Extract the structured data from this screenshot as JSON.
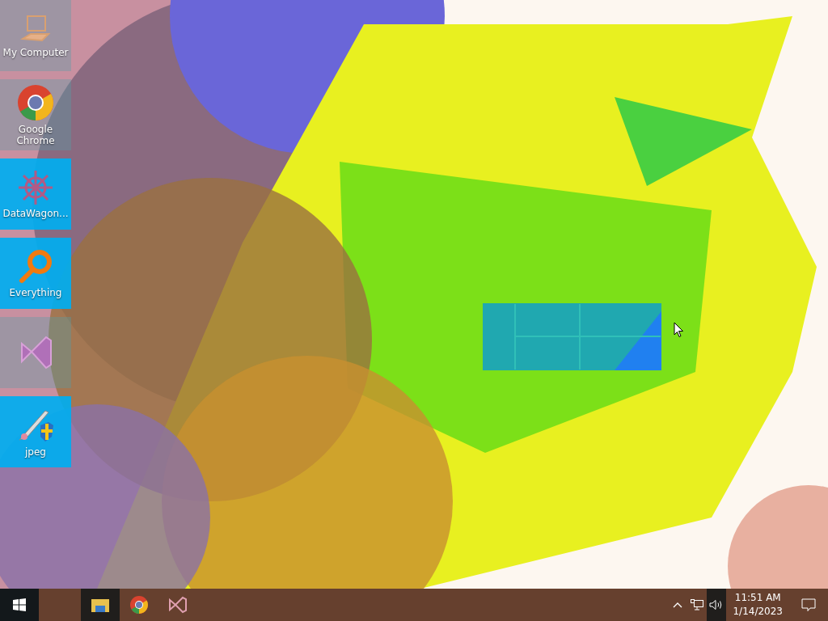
{
  "desktop_icons": [
    {
      "kind": "computer",
      "label": "My Computer",
      "selected": false
    },
    {
      "kind": "chrome",
      "label": "Google Chrome",
      "selected": false
    },
    {
      "kind": "datawagon",
      "label": "DataWagon...",
      "selected": true
    },
    {
      "kind": "everything",
      "label": "Everything",
      "selected": true
    },
    {
      "kind": "visual-studio",
      "selected": false
    },
    {
      "kind": "jpeg",
      "label": "jpeg",
      "selected": true
    }
  ],
  "taskbar": {
    "apps": [
      {
        "kind": "explorer",
        "selected": true
      },
      {
        "kind": "chrome",
        "selected": false
      },
      {
        "kind": "visual-studio",
        "selected": false
      }
    ],
    "tray": [
      {
        "kind": "chevron",
        "selected": false
      },
      {
        "kind": "network",
        "selected": false
      },
      {
        "kind": "volume",
        "selected": true
      }
    ],
    "time": "11:51 AM",
    "date": "1/14/2023"
  }
}
